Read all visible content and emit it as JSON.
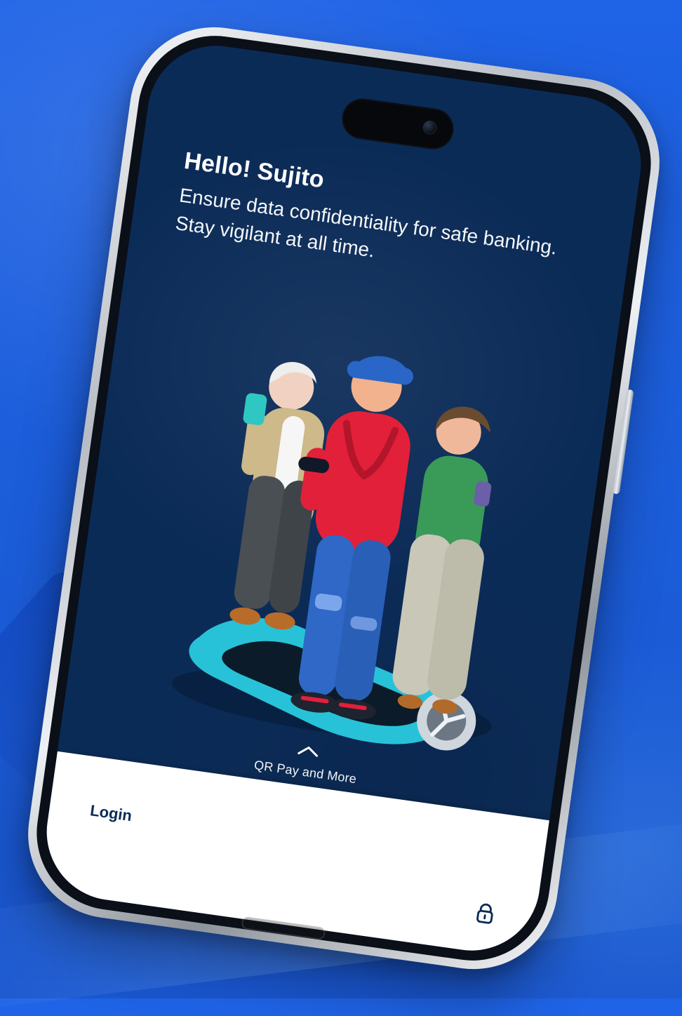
{
  "theme": {
    "background_blue": "#1f63e6",
    "screen_navy": "#0b2b57",
    "text_white": "#ffffff",
    "login_text_navy": "#0b2b57"
  },
  "home": {
    "greeting_title": "Hello! Sujito",
    "greeting_subtitle": "Ensure data confidentiality for safe banking. Stay vigilant at all time."
  },
  "swipe_up": {
    "label": "QR Pay and More",
    "icon": "chevron-up-icon"
  },
  "login_sheet": {
    "label": "Login",
    "lock_icon": "lock-icon"
  }
}
